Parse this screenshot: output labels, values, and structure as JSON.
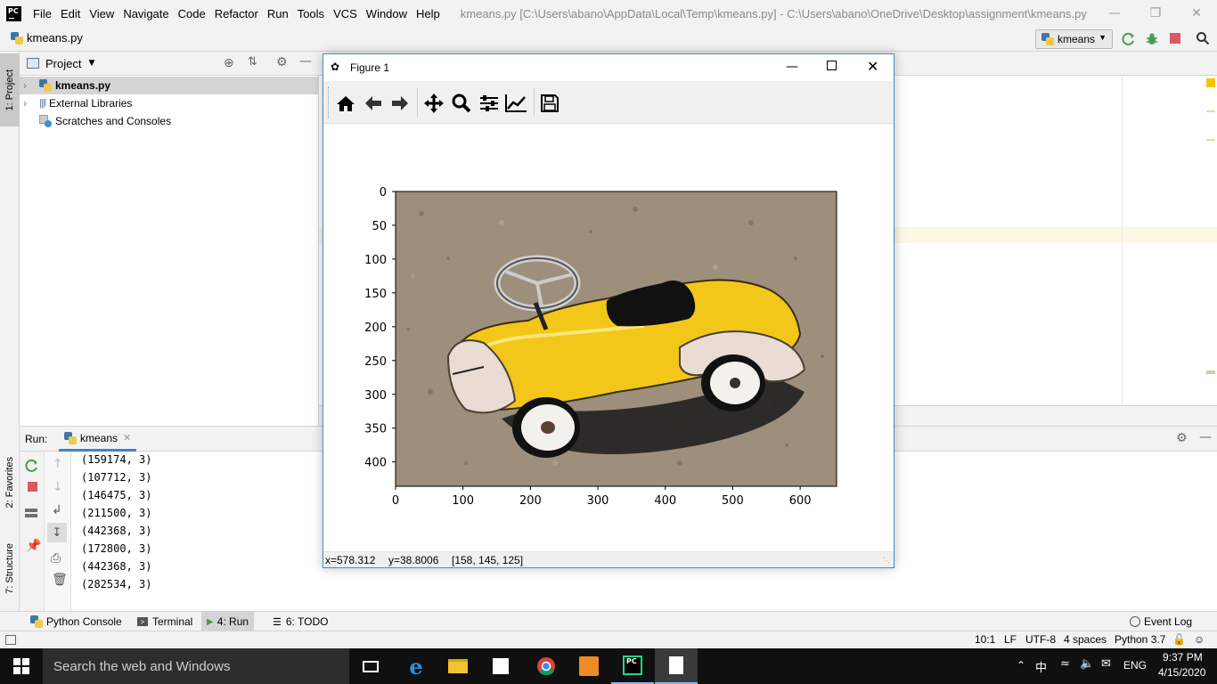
{
  "titlebar": {
    "logo_text": "PC",
    "menus": [
      "File",
      "Edit",
      "View",
      "Navigate",
      "Code",
      "Refactor",
      "Run",
      "Tools",
      "VCS",
      "Window",
      "Help"
    ],
    "window_path": "kmeans.py [C:\\Users\\abano\\AppData\\Local\\Temp\\kmeans.py] - C:\\Users\\abano\\OneDrive\\Desktop\\assignment\\kmeans.py"
  },
  "navbar": {
    "file": "kmeans.py",
    "run_config": "kmeans"
  },
  "left_strip": {
    "project_tab": "1: Project",
    "favorites_tab": "2: Favorites",
    "structure_tab": "7: Structure"
  },
  "project": {
    "title": "Project",
    "items": [
      {
        "label": "kmeans.py",
        "icon": "python-file-icon"
      },
      {
        "label": "External Libraries",
        "icon": "library-icon"
      },
      {
        "label": "Scratches and Consoles",
        "icon": "scratches-icon"
      }
    ]
  },
  "figure": {
    "title": "Figure 1",
    "status": {
      "x": "x=578.312",
      "y": "y=38.8006",
      "rgb": "[158, 145, 125]"
    },
    "tools": [
      "home-icon",
      "back-icon",
      "forward-icon",
      "pan-icon",
      "zoom-icon",
      "configure-subplots-icon",
      "edit-axis-icon",
      "save-icon"
    ],
    "x_ticks": [
      "0",
      "100",
      "200",
      "300",
      "400",
      "500",
      "600"
    ],
    "y_ticks": [
      "0",
      "50",
      "100",
      "150",
      "200",
      "250",
      "300",
      "350",
      "400"
    ]
  },
  "run": {
    "label": "Run:",
    "tab": "kmeans",
    "output": [
      "(159174, 3)",
      "(107712, 3)",
      "(146475, 3)",
      "(211500, 3)",
      "(442368, 3)",
      "(172800, 3)",
      "(442368, 3)",
      "(282534, 3)"
    ]
  },
  "toolwindows": {
    "python_console": "Python Console",
    "terminal": "Terminal",
    "run": "4: Run",
    "todo": "6: TODO",
    "event_log": "Event Log"
  },
  "statusbar": {
    "position": "10:1",
    "line_sep": "LF",
    "encoding": "UTF-8",
    "indent": "4 spaces",
    "interpreter": "Python 3.7"
  },
  "taskbar": {
    "search_placeholder": "Search the web and Windows",
    "time": "9:37 PM",
    "date": "4/15/2020",
    "language": "ENG"
  },
  "colors": {
    "accent": "#3d8fd6",
    "run_green": "#499c54",
    "stop_red": "#db5860",
    "car_yellow": "#f2c71a"
  }
}
